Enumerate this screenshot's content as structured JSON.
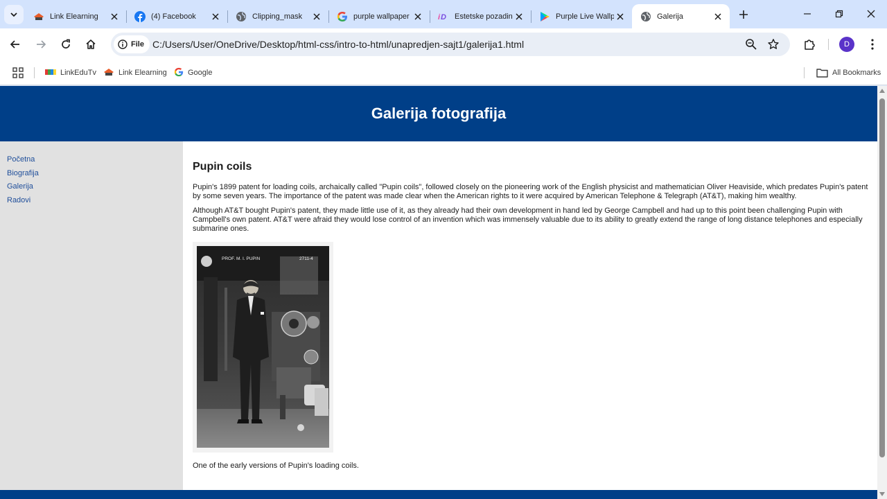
{
  "browser": {
    "tabs": [
      {
        "title": "Link Elearning",
        "icon": "link-elearning-icon"
      },
      {
        "title": "(4) Facebook",
        "icon": "facebook-icon"
      },
      {
        "title": "Clipping_mask",
        "icon": "globe-icon"
      },
      {
        "title": "purple wallpaper",
        "icon": "google-icon"
      },
      {
        "title": "Estetske pozadine",
        "icon": "estetske-icon"
      },
      {
        "title": "Purple Live Wallpapers",
        "icon": "play-store-icon"
      },
      {
        "title": "Galerija",
        "icon": "globe-icon",
        "active": true
      }
    ],
    "omnibox": {
      "chip_label": "File",
      "url": "C:/Users/User/OneDrive/Desktop/html-css/intro-to-html/unapredjen-sajt1/galerija1.html"
    },
    "profile_initial": "D",
    "bookmarks": [
      {
        "label": "LinkEduTv",
        "icon": "linkedutv-icon"
      },
      {
        "label": "Link Elearning",
        "icon": "link-elearning-icon"
      },
      {
        "label": "Google",
        "icon": "google-icon"
      }
    ],
    "all_bookmarks_label": "All Bookmarks"
  },
  "page": {
    "header_title": "Galerija fotografija",
    "nav": [
      "Početna",
      "Biografija",
      "Galerija",
      "Radovi"
    ],
    "article": {
      "heading": "Pupin coils",
      "paragraphs": [
        "Pupin's 1899 patent for loading coils, archaically called \"Pupin coils\", followed closely on the pioneering work of the English physicist and mathematician Oliver Heaviside, which predates Pupin's patent by some seven years. The importance of the patent was made clear when the American rights to it were acquired by American Telephone & Telegraph (AT&T), making him wealthy.",
        "Although AT&T bought Pupin's patent, they made little use of it, as they already had their own development in hand led by George Campbell and had up to this point been challenging Pupin with Campbell's own patent. AT&T were afraid they would lose control of an invention which was immensely valuable due to its ability to greatly extend the range of long distance telephones and especially submarine ones."
      ],
      "photo_caption_on_image": "PROF. M. I. PUPIN",
      "photo_number_on_image": "2711-4",
      "caption": "One of the early versions of Pupin's loading coils."
    }
  }
}
